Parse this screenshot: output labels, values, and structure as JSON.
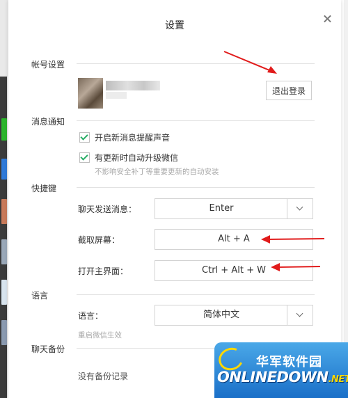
{
  "dialog": {
    "title": "设置"
  },
  "account": {
    "section_label": "帐号设置",
    "logout_label": "退出登录"
  },
  "notifications": {
    "section_label": "消息通知",
    "sound_label": "开启新消息提醒声音",
    "sound_checked": true,
    "autoupdate_label": "有更新时自动升级微信",
    "autoupdate_checked": true,
    "autoupdate_hint": "不影响安全补丁等重要更新的自动安装"
  },
  "shortcuts": {
    "section_label": "快捷键",
    "send_label": "聊天发送消息：",
    "send_value": "Enter",
    "screenshot_label": "截取屏幕：",
    "screenshot_value": "Alt + A",
    "open_label": "打开主界面：",
    "open_value": "Ctrl + Alt + W"
  },
  "language": {
    "section_label": "语言",
    "label": "语言：",
    "value": "简体中文",
    "hint": "重启微信生效"
  },
  "backup": {
    "section_label": "聊天备份",
    "empty_text": "没有备份记录"
  },
  "watermark": {
    "cn": "华军软件园",
    "en": "ONLINEDOWN",
    "suffix": ".NET"
  },
  "colors": {
    "accent": "#2aae67",
    "annotation_arrow": "#e11b1b"
  }
}
